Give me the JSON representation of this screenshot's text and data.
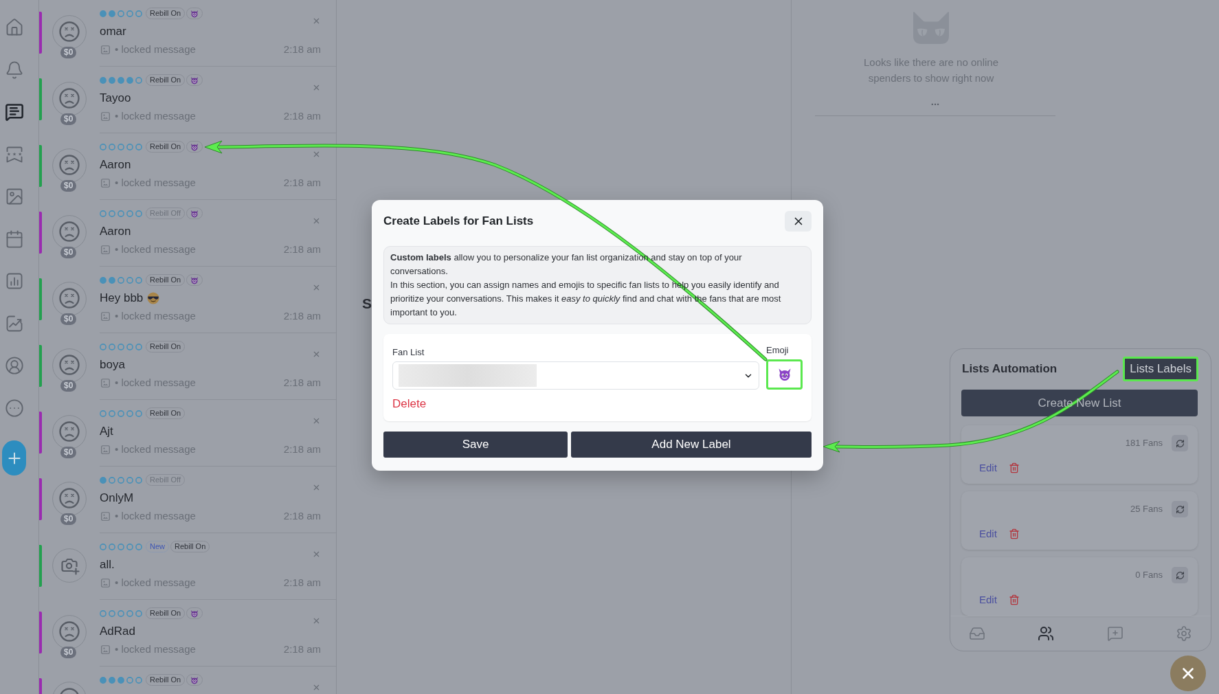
{
  "sidebar": {
    "items": [
      {
        "kind": "home",
        "selected": false
      },
      {
        "kind": "bell",
        "selected": false
      },
      {
        "kind": "chat",
        "selected": true
      },
      {
        "kind": "ribbon",
        "selected": false
      },
      {
        "kind": "gallery",
        "selected": false
      },
      {
        "kind": "calendar",
        "selected": false
      },
      {
        "kind": "bars",
        "selected": false
      },
      {
        "kind": "trend",
        "selected": false
      },
      {
        "kind": "profile",
        "selected": false
      },
      {
        "kind": "more",
        "selected": false
      }
    ]
  },
  "chats": [
    {
      "kind": "face",
      "color": "#9a2bb0",
      "spend": "$0",
      "stars": 2,
      "rebill": "Rebill On",
      "rebill_active": true,
      "label_emoji": true,
      "name": "omar",
      "name_emoji": false,
      "preview": "• locked message",
      "time": "2:18 am"
    },
    {
      "kind": "face",
      "color": "#23a04f",
      "spend": "$0",
      "stars": 4,
      "rebill": "Rebill On",
      "rebill_active": true,
      "label_emoji": true,
      "name": "Tayoo",
      "name_emoji": false,
      "preview": "• locked message",
      "time": "2:18 am"
    },
    {
      "kind": "face",
      "color": "#23a04f",
      "spend": "$0",
      "stars": 0,
      "rebill": "Rebill On",
      "rebill_active": true,
      "label_emoji": true,
      "name": "Aaron",
      "name_emoji": false,
      "preview": "• locked message",
      "time": "2:18 am"
    },
    {
      "kind": "face",
      "color": "#9a2bb0",
      "spend": "$0",
      "stars": 0,
      "rebill": "Rebill Off",
      "rebill_active": false,
      "label_emoji": true,
      "name": "Aaron",
      "name_emoji": false,
      "preview": "• locked message",
      "time": "2:18 am"
    },
    {
      "kind": "face",
      "color": "#23a04f",
      "spend": "$0",
      "stars": 2,
      "rebill": "Rebill On",
      "rebill_active": true,
      "label_emoji": true,
      "name": "Hey bbb",
      "name_emoji": true,
      "preview": "• locked message",
      "time": "2:18 am"
    },
    {
      "kind": "face",
      "color": "#23a04f",
      "spend": "$0",
      "stars": 0,
      "rebill": "Rebill On",
      "rebill_active": true,
      "label_emoji": false,
      "name": "boya",
      "name_emoji": false,
      "preview": "• locked message",
      "time": "2:18 am"
    },
    {
      "kind": "face",
      "color": "#9a2bb0",
      "spend": "$0",
      "stars": 0,
      "rebill": "Rebill On",
      "rebill_active": true,
      "label_emoji": false,
      "name": "Ajt",
      "name_emoji": false,
      "preview": "• locked message",
      "time": "2:18 am"
    },
    {
      "kind": "face",
      "color": "#9a2bb0",
      "spend": "$0",
      "stars": 1,
      "rebill": "Rebill Off",
      "rebill_active": false,
      "label_emoji": false,
      "name": "OnlyM",
      "name_emoji": false,
      "preview": "• locked message",
      "time": "2:18 am"
    },
    {
      "kind": "camera",
      "color": "#23a04f",
      "stars": 0,
      "new_tag": "New",
      "rebill": "Rebill On",
      "rebill_active": true,
      "label_emoji": false,
      "name": "all.",
      "name_emoji": false,
      "preview": "• locked message",
      "time": "2:18 am"
    },
    {
      "kind": "face",
      "color": "#9a2bb0",
      "spend": "$0",
      "stars": 0,
      "rebill": "Rebill On",
      "rebill_active": true,
      "label_emoji": true,
      "name": "AdRad",
      "name_emoji": false,
      "preview": "• locked message",
      "time": "2:18 am"
    },
    {
      "kind": "face",
      "color": "#9a2bb0",
      "stars": 3,
      "rebill": "Rebill On",
      "rebill_active": true,
      "label_emoji": true
    }
  ],
  "center_panel": {
    "text_fragment": "S"
  },
  "online_spenders": {
    "message": "Looks like there are no online spenders to show right now",
    "more": "..."
  },
  "lists_automation": {
    "title": "Lists Automation",
    "labels_button": {
      "label": "Lists Labels",
      "highlighted": true
    },
    "create_button": "Create New List",
    "lists": [
      {
        "fans": "181 Fans",
        "action": "Edit"
      },
      {
        "fans": "25 Fans",
        "action": "Edit"
      },
      {
        "fans": "0 Fans",
        "action": "Edit"
      }
    ],
    "nav": [
      {
        "kind": "inbox",
        "selected": false
      },
      {
        "kind": "users",
        "selected": true
      },
      {
        "kind": "compose",
        "selected": false
      },
      {
        "kind": "settings",
        "selected": false
      }
    ]
  },
  "modal": {
    "title": "Create Labels for Fan Lists",
    "description": [
      "**Custom labels** allow you to personalize your fan list organization and stay on top of your conversations.",
      "In this section, you can assign names and emojis to specific fan lists to help you easily identify and prioritize your conversations. This makes it *easy to quickly* find and chat with the fans that are most important to you."
    ],
    "fan_list_label": "Fan List",
    "emoji_label": "Emoji",
    "emoji_button": {
      "highlighted": true
    },
    "delete": "Delete",
    "buttons": [
      "Save",
      "Add New Label"
    ]
  }
}
